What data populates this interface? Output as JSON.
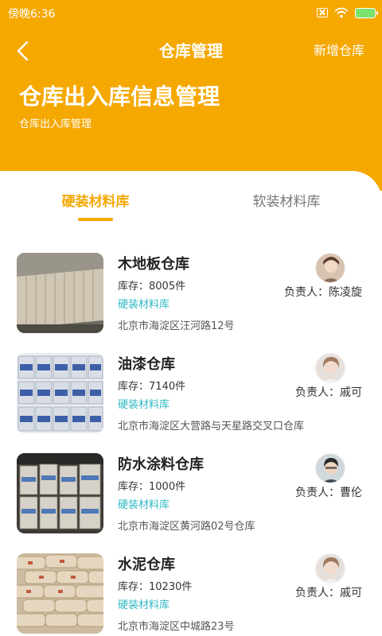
{
  "status_bar": {
    "time": "傍晚6:36",
    "battery_color": "#7BE36B"
  },
  "header": {
    "back_icon": "back-arrow-icon",
    "title": "仓库管理",
    "action": "新增仓库",
    "hero_title": "仓库出入库信息管理",
    "hero_subtitle": "仓库出入库管理",
    "background_color": "#F5A800"
  },
  "tabs": [
    {
      "label": "硬装材料库",
      "active": true
    },
    {
      "label": "软装材料库",
      "active": false
    }
  ],
  "warehouses": [
    {
      "name": "木地板仓库",
      "stock": "库存：8005件",
      "category": "硬装材料库",
      "address": "北京市海淀区汪河路12号",
      "owner": "负责人：陈凌旋"
    },
    {
      "name": "油漆仓库",
      "stock": "库存：7140件",
      "category": "硬装材料库",
      "address": "北京市海淀区大营路与天星路交叉口仓库",
      "owner": "负责人：戚可"
    },
    {
      "name": "防水涂料仓库",
      "stock": "库存：1000件",
      "category": "硬装材料库",
      "address": "北京市海淀区黄河路02号仓库",
      "owner": "负责人：曹伦"
    },
    {
      "name": "水泥仓库",
      "stock": "库存：10230件",
      "category": "硬装材料库",
      "address": "北京市海淀区中城路23号",
      "owner": "负责人：戚可"
    }
  ],
  "colors": {
    "accent": "#F5A800",
    "category": "#2EB8C4"
  }
}
